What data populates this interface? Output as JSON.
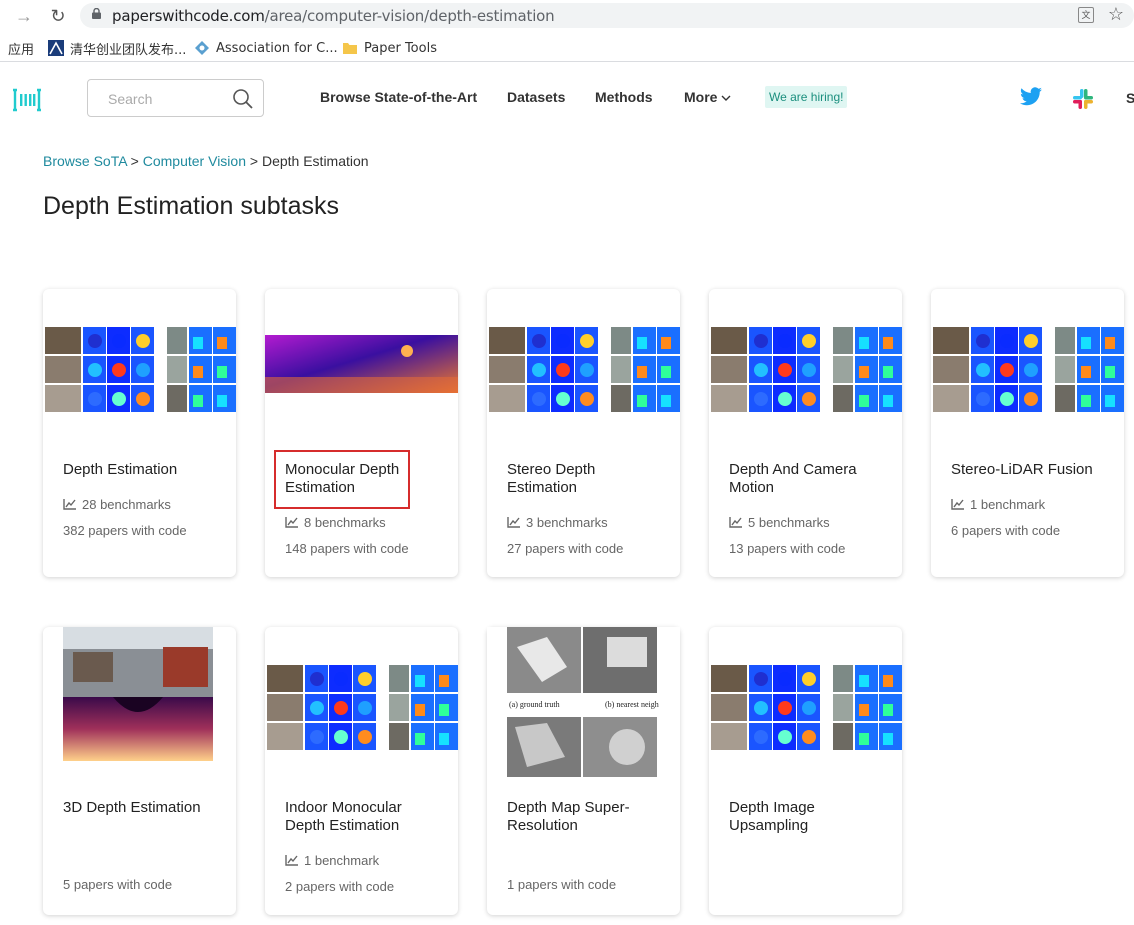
{
  "browser": {
    "url_host": "paperswithcode.com",
    "url_path": "/area/computer-vision/depth-estimation",
    "bookmarks": [
      "应用",
      "清华创业团队发布...",
      "Association for C...",
      "Paper Tools"
    ]
  },
  "header": {
    "search_placeholder": "Search",
    "nav": [
      "Browse State-of-the-Art",
      "Datasets",
      "Methods",
      "More"
    ],
    "hiring": "We are hiring!",
    "cut_text": "S"
  },
  "breadcrumb": {
    "items": [
      "Browse SoTA",
      "Computer Vision",
      "Depth Estimation"
    ],
    "sep": ">"
  },
  "page_title": "Depth Estimation subtasks",
  "cards": [
    {
      "title": "Depth Estimation",
      "benchmarks": "28 benchmarks",
      "papers": "382 papers with code",
      "thumb": "grid"
    },
    {
      "title": "Monocular Depth Estimation",
      "benchmarks": "8 benchmarks",
      "papers": "148 papers with code",
      "thumb": "purple",
      "highlighted": true
    },
    {
      "title": "Stereo Depth Estimation",
      "benchmarks": "3 benchmarks",
      "papers": "27 papers with code",
      "thumb": "grid"
    },
    {
      "title": "Depth And Camera Motion",
      "benchmarks": "5 benchmarks",
      "papers": "13 papers with code",
      "thumb": "grid"
    },
    {
      "title": "Stereo-LiDAR Fusion",
      "benchmarks": "1 benchmark",
      "papers": "6 papers with code",
      "thumb": "grid"
    },
    {
      "title": "3D Depth Estimation",
      "benchmarks": "",
      "papers": "5 papers with code",
      "thumb": "street"
    },
    {
      "title": "Indoor Monocular Depth Estimation",
      "benchmarks": "1 benchmark",
      "papers": "2 papers with code",
      "thumb": "grid"
    },
    {
      "title": "Depth Map Super-Resolution",
      "benchmarks": "",
      "papers": "1 papers with code",
      "thumb": "gray",
      "thumb_labels": [
        "(a) ground truth",
        "(b) nearest neigh"
      ]
    },
    {
      "title": "Depth Image Upsampling",
      "benchmarks": "",
      "papers": "",
      "thumb": "grid"
    }
  ],
  "colors": {
    "accent": "#1f8a9e",
    "highlight": "#d62c2c",
    "hiring_bg": "#dff6f2"
  }
}
